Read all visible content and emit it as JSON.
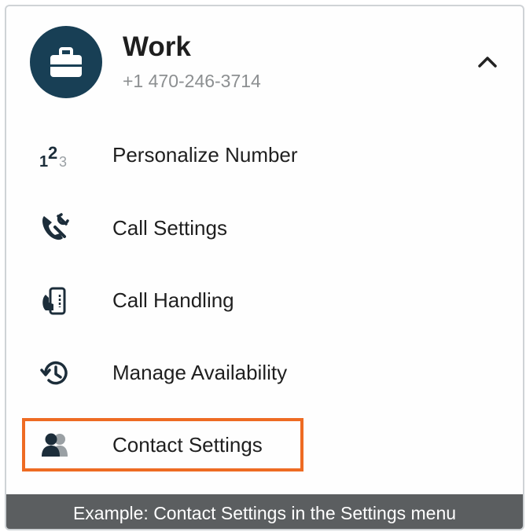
{
  "account": {
    "name": "Work",
    "number": "+1 470-246-3714",
    "avatar_icon": "briefcase-icon",
    "collapse_icon": "chevron-up-icon"
  },
  "menu": {
    "items": [
      {
        "label": "Personalize Number",
        "icon": "numbers-123-icon"
      },
      {
        "label": "Call Settings",
        "icon": "phone-wrench-icon"
      },
      {
        "label": "Call Handling",
        "icon": "phone-handling-icon"
      },
      {
        "label": "Manage Availability",
        "icon": "history-clock-icon"
      },
      {
        "label": "Contact Settings",
        "icon": "contacts-icon",
        "highlighted": true
      }
    ]
  },
  "caption": "Example: Contact Settings in the Settings menu",
  "colors": {
    "avatar_bg": "#183f55",
    "icon": "#1c2d3a",
    "highlight": "#ee6b23",
    "caption_bg": "#5b5e60"
  }
}
